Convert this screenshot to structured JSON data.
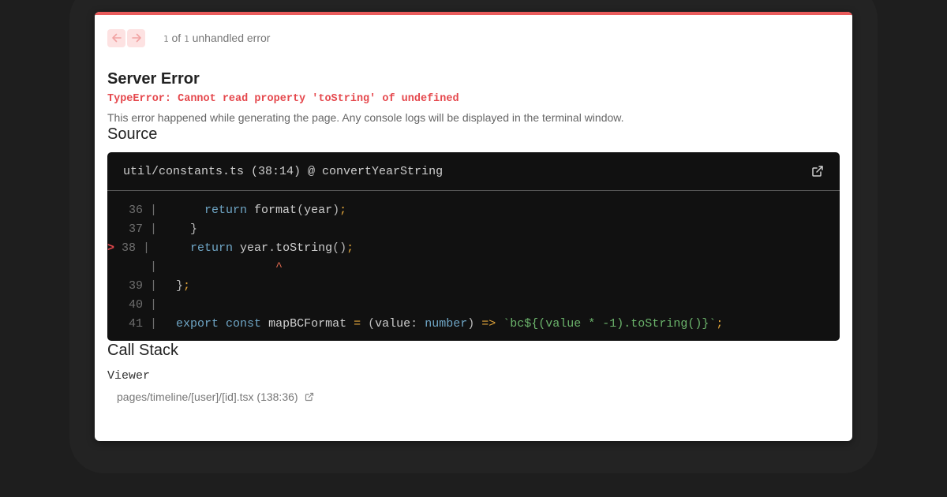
{
  "nav": {
    "prev_icon": "arrow-left-icon",
    "next_icon": "arrow-right-icon",
    "current": "1",
    "of_label": "of",
    "total": "1",
    "suffix": "unhandled error"
  },
  "error": {
    "title": "Server Error",
    "message": "TypeError: Cannot read property 'toString' of undefined",
    "description": "This error happened while generating the page. Any console logs will be displayed in the terminal window."
  },
  "source": {
    "heading": "Source",
    "location": "util/constants.ts (38:14) @ convertYearString",
    "open_icon": "external-link-icon",
    "lines": [
      {
        "gutter": "   36 |",
        "code": "    return format(year);"
      },
      {
        "gutter": "   37 |",
        "code": "  }"
      },
      {
        "marker": ">",
        "gutter": " 38 |",
        "code": "  return year.toString();"
      },
      {
        "gutter": "      |",
        "code": "              ^"
      },
      {
        "gutter": "   39 |",
        "code": "};"
      },
      {
        "gutter": "   40 |",
        "code": ""
      },
      {
        "gutter": "   41 |",
        "code": "export const mapBCFormat = (value: number) => `bc${(value * -1).toString()}`;"
      }
    ]
  },
  "call_stack": {
    "heading": "Call Stack",
    "frames": [
      {
        "function": "Viewer",
        "file": "pages/timeline/[user]/[id].tsx (138:36)"
      }
    ]
  },
  "colors": {
    "accent": "#e95b5b",
    "error_text": "#e5484d",
    "code_bg": "#111111"
  }
}
